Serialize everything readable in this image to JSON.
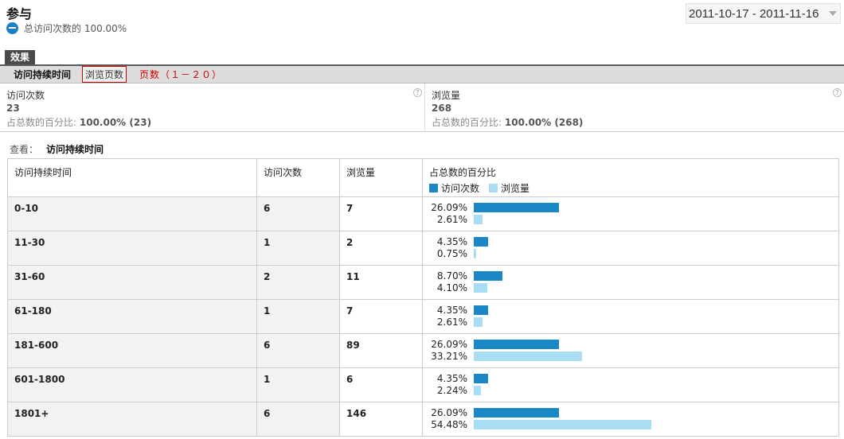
{
  "header": {
    "title": "参与",
    "subtitle": "总访问次数的 100.00%",
    "date_range": "2011-10-17 - 2011-11-16"
  },
  "section": {
    "label": "效果"
  },
  "tabs": {
    "active": "访问持续时间",
    "boxed": "浏览页数",
    "pages": "页数（１－２０）"
  },
  "metrics": [
    {
      "name": "访问次数",
      "value": "23",
      "pct_label": "占总数的百分比:",
      "pct_value": "100.00% (23)"
    },
    {
      "name": "浏览量",
      "value": "268",
      "pct_label": "占总数的百分比:",
      "pct_value": "100.00% (268)"
    }
  ],
  "view": {
    "label": "查看：",
    "value": "访问持续时间"
  },
  "colors": {
    "visits": "#1b87c7",
    "pageviews": "#a9ddf3"
  },
  "table": {
    "headers": [
      "访问持续时间",
      "访问次数",
      "浏览量",
      "占总数的百分比"
    ],
    "legend": [
      "访问次数",
      "浏览量"
    ],
    "rows": [
      {
        "range": "0-10",
        "visits": "6",
        "pageviews": "7",
        "visits_pct": "26.09%",
        "pageviews_pct": "2.61%"
      },
      {
        "range": "11-30",
        "visits": "1",
        "pageviews": "2",
        "visits_pct": "4.35%",
        "pageviews_pct": "0.75%"
      },
      {
        "range": "31-60",
        "visits": "2",
        "pageviews": "11",
        "visits_pct": "8.70%",
        "pageviews_pct": "4.10%"
      },
      {
        "range": "61-180",
        "visits": "1",
        "pageviews": "7",
        "visits_pct": "4.35%",
        "pageviews_pct": "2.61%"
      },
      {
        "range": "181-600",
        "visits": "6",
        "pageviews": "89",
        "visits_pct": "26.09%",
        "pageviews_pct": "33.21%"
      },
      {
        "range": "601-1800",
        "visits": "1",
        "pageviews": "6",
        "visits_pct": "4.35%",
        "pageviews_pct": "2.24%"
      },
      {
        "range": "1801+",
        "visits": "6",
        "pageviews": "146",
        "visits_pct": "26.09%",
        "pageviews_pct": "54.48%"
      }
    ]
  }
}
